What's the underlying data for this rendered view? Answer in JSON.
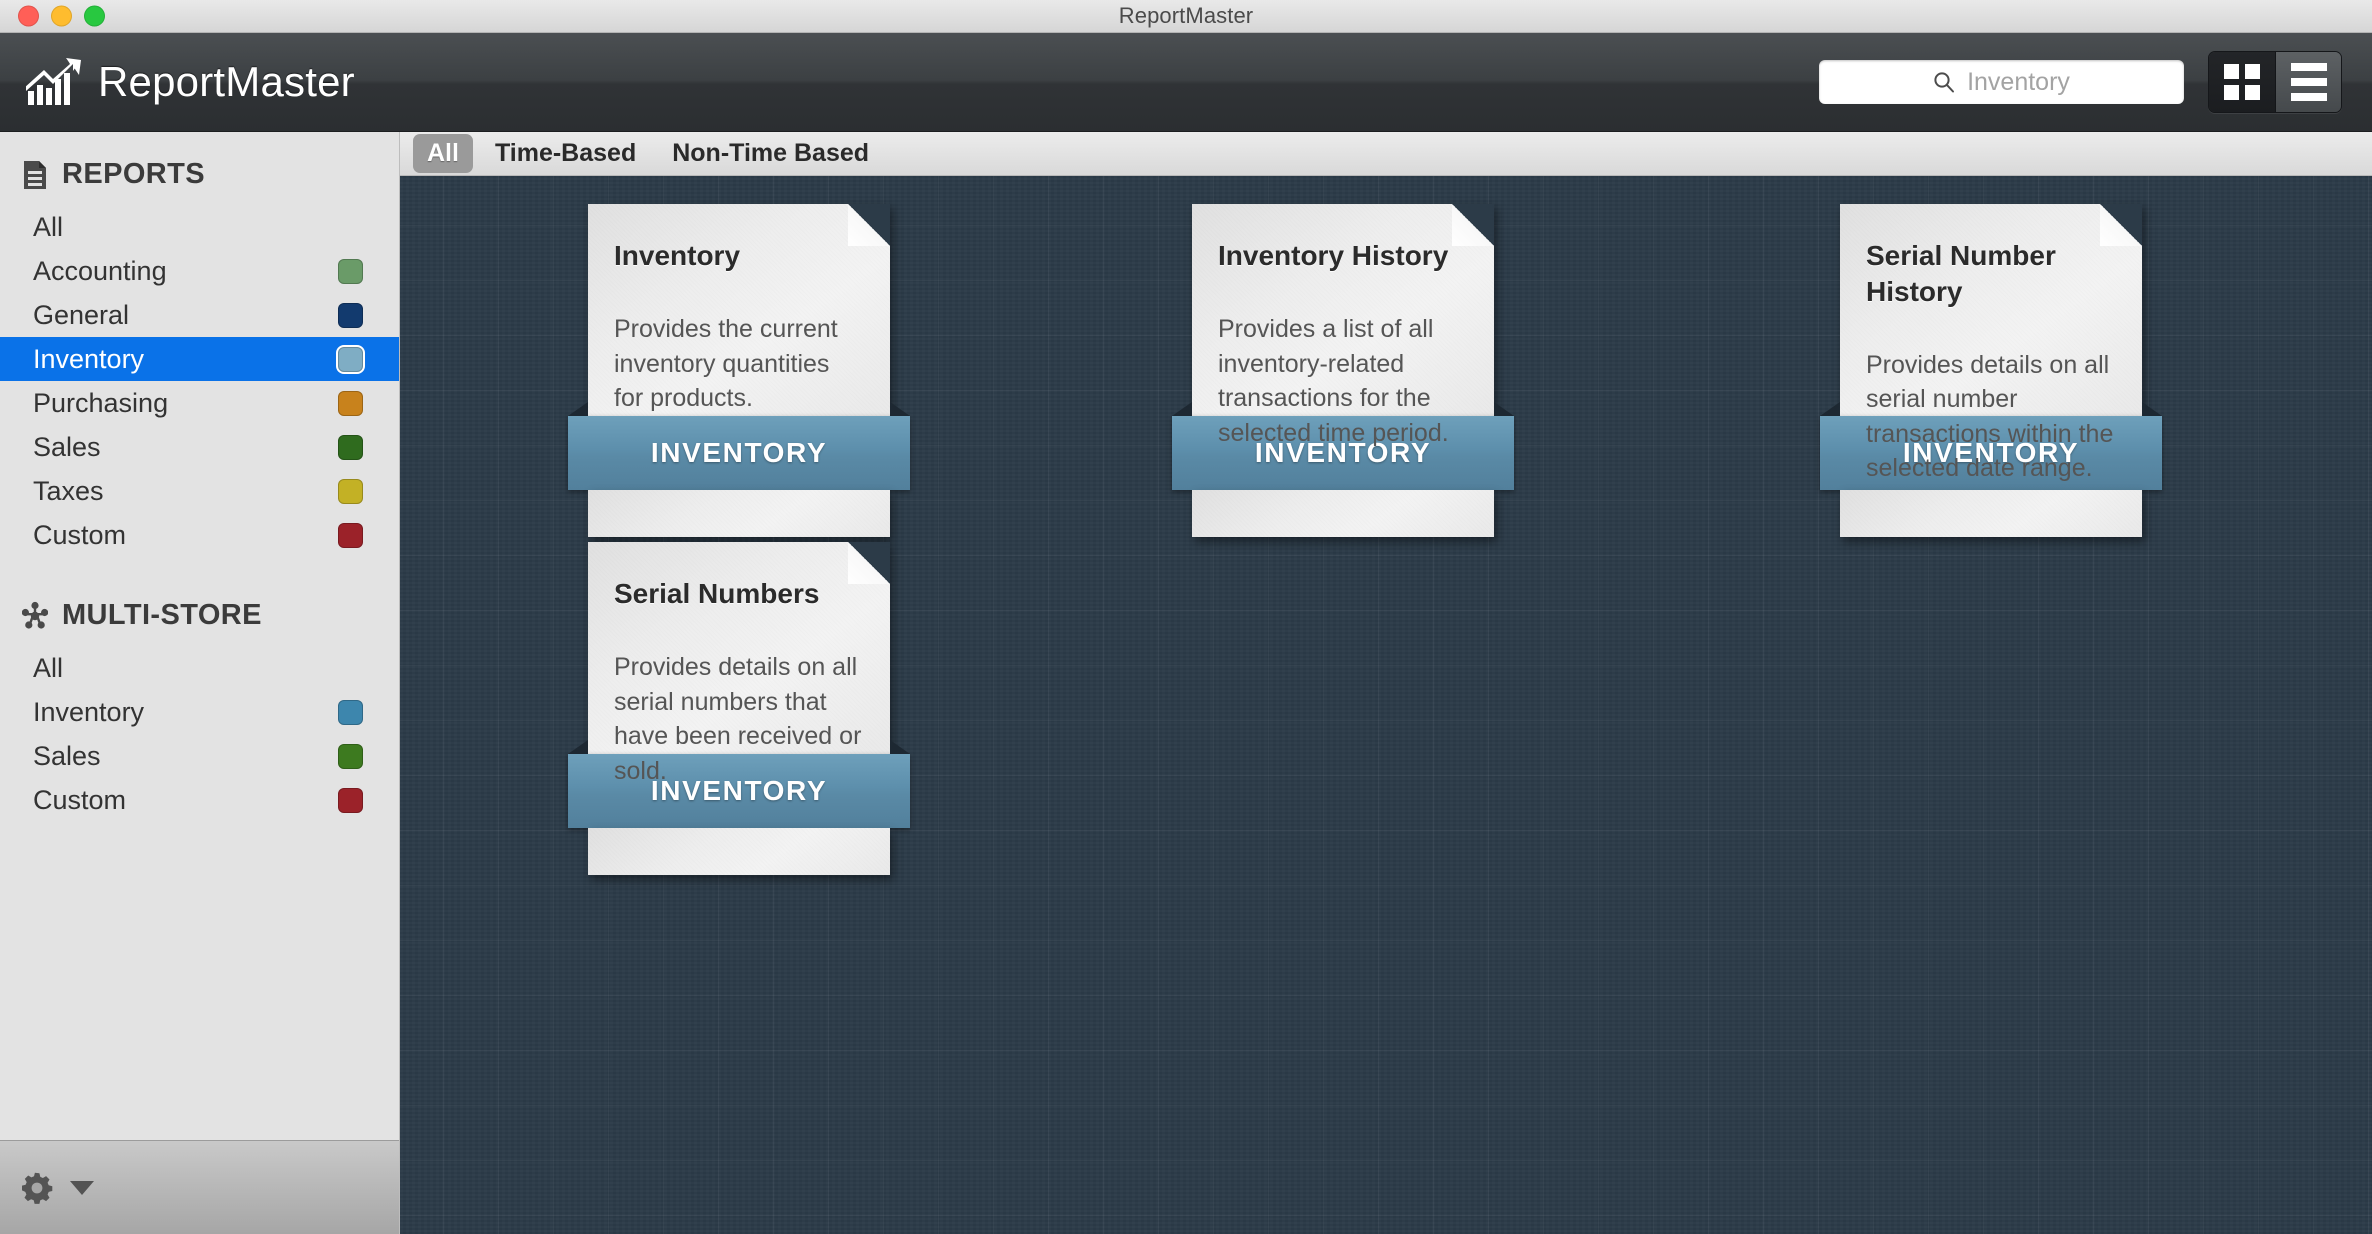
{
  "window": {
    "title": "ReportMaster",
    "controls": [
      "close",
      "minimize",
      "zoom"
    ]
  },
  "header": {
    "app_name": "ReportMaster",
    "logo_icon": "bar-chart-arrow-icon",
    "search": {
      "icon": "search-icon",
      "placeholder": "Inventory",
      "value": ""
    },
    "view_toggle": {
      "grid_label": "grid-view-icon",
      "list_label": "list-view-icon",
      "selected": "grid"
    }
  },
  "sidebar": {
    "sections": [
      {
        "icon": "document-icon",
        "title": "REPORTS",
        "items": [
          {
            "label": "All",
            "color": null,
            "selected": false
          },
          {
            "label": "Accounting",
            "color": "#6a9b68",
            "selected": false
          },
          {
            "label": "General",
            "color": "#123a6e",
            "selected": false
          },
          {
            "label": "Inventory",
            "color": "#7fadc4",
            "selected": true
          },
          {
            "label": "Purchasing",
            "color": "#c8821c",
            "selected": false
          },
          {
            "label": "Sales",
            "color": "#2f6b1e",
            "selected": false
          },
          {
            "label": "Taxes",
            "color": "#c3b125",
            "selected": false
          },
          {
            "label": "Custom",
            "color": "#9b2229",
            "selected": false
          }
        ]
      },
      {
        "icon": "multi-store-hub-icon",
        "title": "MULTI-STORE",
        "items": [
          {
            "label": "All",
            "color": null,
            "selected": false
          },
          {
            "label": "Inventory",
            "color": "#3d86ad",
            "selected": false
          },
          {
            "label": "Sales",
            "color": "#3d7a1f",
            "selected": false
          },
          {
            "label": "Custom",
            "color": "#9b2229",
            "selected": false
          }
        ]
      }
    ],
    "footer": {
      "gear_icon": "gear-icon",
      "caret_icon": "caret-down-icon"
    }
  },
  "filters": {
    "tabs": [
      {
        "label": "All",
        "selected": true
      },
      {
        "label": "Time-Based",
        "selected": false
      },
      {
        "label": "Non-Time Based",
        "selected": false
      }
    ]
  },
  "reports": [
    {
      "title": "Inventory",
      "description": "Provides the current inventory quantities for products.",
      "category": "INVENTORY",
      "category_color": "#5d8fac"
    },
    {
      "title": "Inventory History",
      "description": "Provides a list of all inventory-related transactions for the selected time period.",
      "category": "INVENTORY",
      "category_color": "#5d8fac"
    },
    {
      "title": "Serial Number History",
      "description": "Provides details on all serial number transactions within the selected date range.",
      "category": "INVENTORY",
      "category_color": "#5d8fac"
    },
    {
      "title": "Serial Numbers",
      "description": "Provides details on all serial numbers that have been received or sold.",
      "category": "INVENTORY",
      "category_color": "#5d8fac"
    }
  ],
  "theme": {
    "accent_blue": "#5d8fac",
    "selection_blue": "#0a72e8",
    "canvas_bg": "#2c3b48"
  }
}
